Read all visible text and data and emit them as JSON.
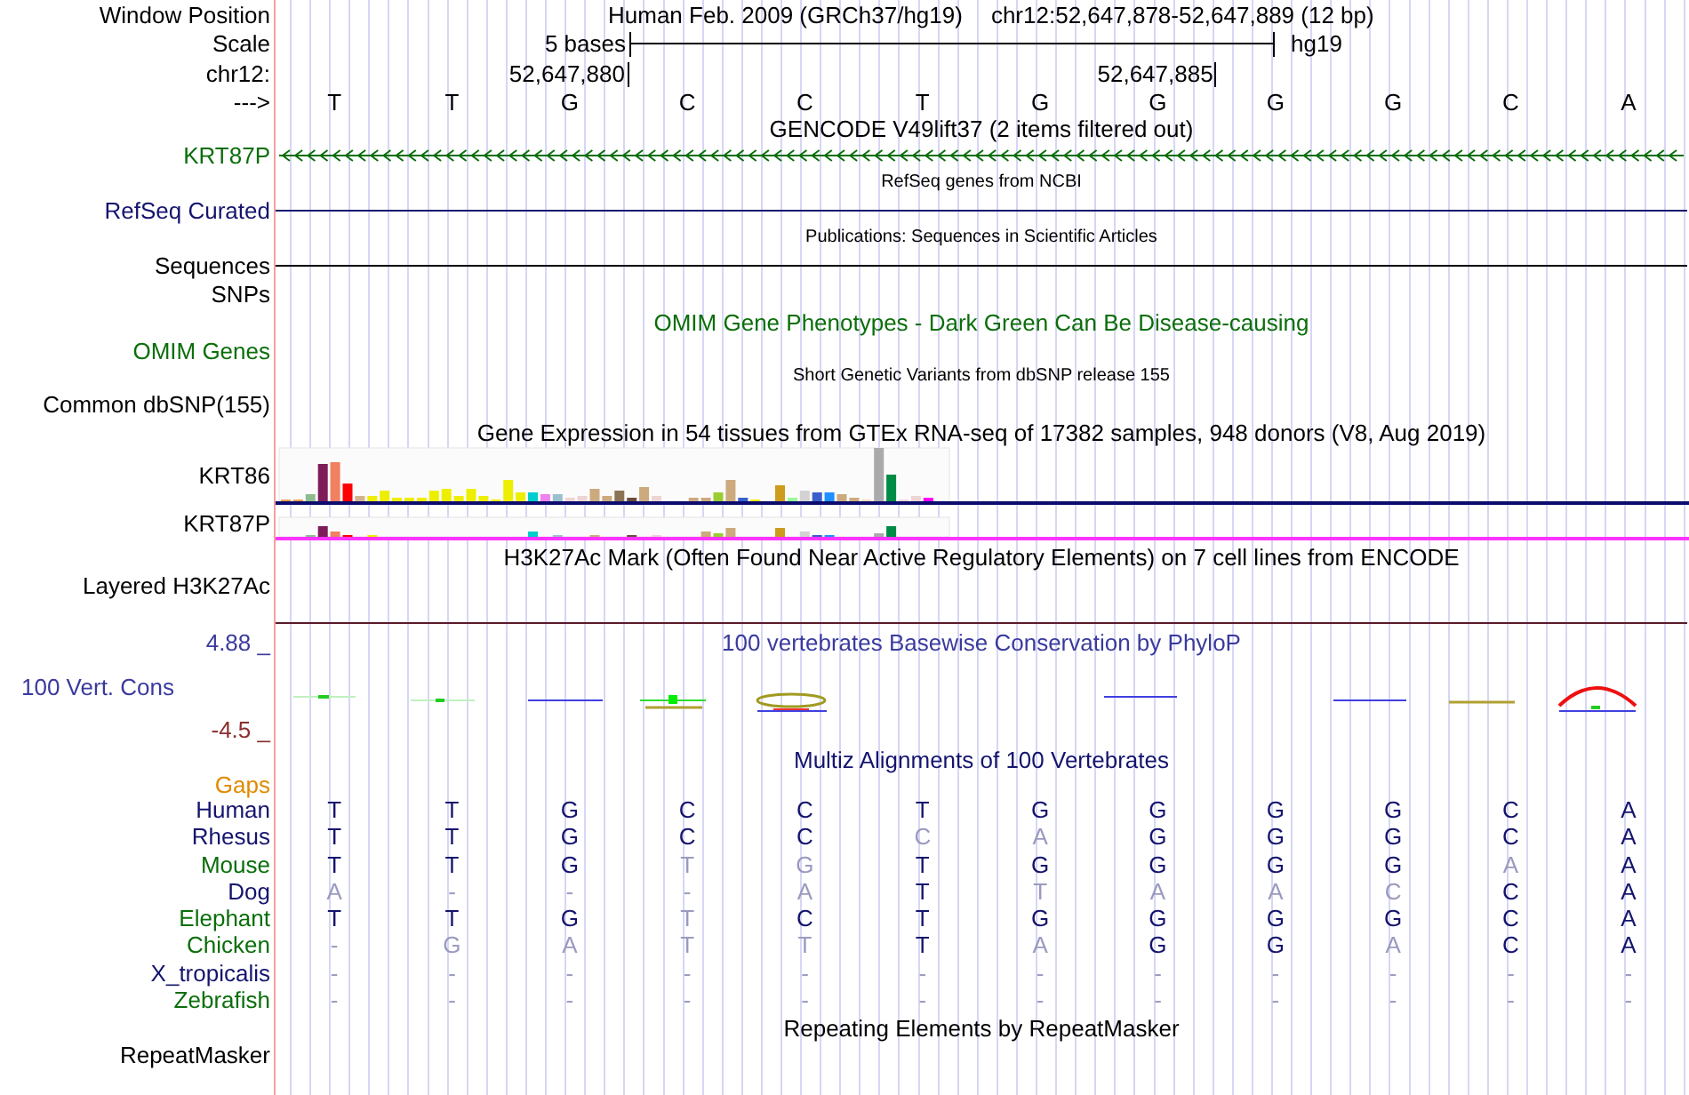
{
  "ruler": {
    "window_position_label": "Window Position",
    "assembly": "Human Feb. 2009 (GRCh37/hg19)",
    "position": "chr12:52,647,878-52,647,889 (12 bp)",
    "scale_label": "Scale",
    "scale_text": "5 bases",
    "scale_assembly": "hg19",
    "chrom_label": "chr12:",
    "ticks": [
      "52,647,880",
      "52,647,885"
    ],
    "strand_label": "--->",
    "bases": [
      "T",
      "T",
      "G",
      "C",
      "C",
      "T",
      "G",
      "G",
      "G",
      "G",
      "C",
      "A"
    ]
  },
  "gencode": {
    "title": "GENCODE V49lift37 (2 items filtered out)",
    "gene": "KRT87P"
  },
  "refseq": {
    "title": "RefSeq genes from NCBI",
    "label": "RefSeq Curated"
  },
  "publications": {
    "title": "Publications: Sequences in Scientific Articles",
    "label": "Sequences"
  },
  "snps": {
    "label": "SNPs"
  },
  "omim": {
    "title": "OMIM Gene Phenotypes - Dark Green Can Be Disease-causing",
    "label": "OMIM Genes"
  },
  "dbsnp": {
    "title": "Short Genetic Variants from dbSNP release 155",
    "label": "Common dbSNP(155)"
  },
  "gtex": {
    "title": "Gene Expression in 54 tissues from GTEx RNA-seq of 17382 samples, 948 donors (V8, Aug 2019)",
    "genes": [
      {
        "label": "KRT86"
      },
      {
        "label": "KRT87P"
      }
    ]
  },
  "h3k27ac": {
    "title": "H3K27Ac Mark (Often Found Near Active Regulatory Elements) on 7 cell lines from ENCODE",
    "label": "Layered H3K27Ac"
  },
  "phylop": {
    "title": "100 vertebrates Basewise Conservation by PhyloP",
    "label": "100 Vert. Cons",
    "y_max": "4.88 _",
    "y_min": "-4.5 _"
  },
  "multiz": {
    "title": "Multiz Alignments of 100 Vertebrates",
    "gaps_label": "Gaps",
    "species": [
      {
        "name": "Human",
        "color": "#14146e",
        "bases": [
          {
            "base": "T",
            "match": true
          },
          {
            "base": "T",
            "match": true
          },
          {
            "base": "G",
            "match": true
          },
          {
            "base": "C",
            "match": true
          },
          {
            "base": "C",
            "match": true
          },
          {
            "base": "T",
            "match": true
          },
          {
            "base": "G",
            "match": true
          },
          {
            "base": "G",
            "match": true
          },
          {
            "base": "G",
            "match": true
          },
          {
            "base": "G",
            "match": true
          },
          {
            "base": "C",
            "match": true
          },
          {
            "base": "A",
            "match": true
          }
        ]
      },
      {
        "name": "Rhesus",
        "color": "#14146e",
        "bases": [
          {
            "base": "T",
            "match": true
          },
          {
            "base": "T",
            "match": true
          },
          {
            "base": "G",
            "match": true
          },
          {
            "base": "C",
            "match": true
          },
          {
            "base": "C",
            "match": true
          },
          {
            "base": "C",
            "match": false
          },
          {
            "base": "A",
            "match": false
          },
          {
            "base": "G",
            "match": true
          },
          {
            "base": "G",
            "match": true
          },
          {
            "base": "G",
            "match": true
          },
          {
            "base": "C",
            "match": true
          },
          {
            "base": "A",
            "match": true
          }
        ]
      },
      {
        "name": "Mouse",
        "color": "#0a6e0a",
        "bases": [
          {
            "base": "T",
            "match": true
          },
          {
            "base": "T",
            "match": true
          },
          {
            "base": "G",
            "match": true
          },
          {
            "base": "T",
            "match": false
          },
          {
            "base": "G",
            "match": false
          },
          {
            "base": "T",
            "match": true
          },
          {
            "base": "G",
            "match": true
          },
          {
            "base": "G",
            "match": true
          },
          {
            "base": "G",
            "match": true
          },
          {
            "base": "G",
            "match": true
          },
          {
            "base": "A",
            "match": false
          },
          {
            "base": "A",
            "match": true
          }
        ]
      },
      {
        "name": "Dog",
        "color": "#14146e",
        "bases": [
          {
            "base": "A",
            "match": false
          },
          {
            "base": "-",
            "match": false
          },
          {
            "base": "-",
            "match": false
          },
          {
            "base": "-",
            "match": false
          },
          {
            "base": "A",
            "match": false
          },
          {
            "base": "T",
            "match": true
          },
          {
            "base": "T",
            "match": false
          },
          {
            "base": "A",
            "match": false
          },
          {
            "base": "A",
            "match": false
          },
          {
            "base": "C",
            "match": false
          },
          {
            "base": "C",
            "match": true
          },
          {
            "base": "A",
            "match": true
          }
        ]
      },
      {
        "name": "Elephant",
        "color": "#0a6e0a",
        "bases": [
          {
            "base": "T",
            "match": true
          },
          {
            "base": "T",
            "match": true
          },
          {
            "base": "G",
            "match": true
          },
          {
            "base": "T",
            "match": false
          },
          {
            "base": "C",
            "match": true
          },
          {
            "base": "T",
            "match": true
          },
          {
            "base": "G",
            "match": true
          },
          {
            "base": "G",
            "match": true
          },
          {
            "base": "G",
            "match": true
          },
          {
            "base": "G",
            "match": true
          },
          {
            "base": "C",
            "match": true
          },
          {
            "base": "A",
            "match": true
          }
        ]
      },
      {
        "name": "Chicken",
        "color": "#0a6e0a",
        "bases": [
          {
            "base": "-",
            "match": false
          },
          {
            "base": "G",
            "match": false
          },
          {
            "base": "A",
            "match": false
          },
          {
            "base": "T",
            "match": false
          },
          {
            "base": "T",
            "match": false
          },
          {
            "base": "T",
            "match": true
          },
          {
            "base": "A",
            "match": false
          },
          {
            "base": "G",
            "match": true
          },
          {
            "base": "G",
            "match": true
          },
          {
            "base": "A",
            "match": false
          },
          {
            "base": "C",
            "match": true
          },
          {
            "base": "A",
            "match": true
          }
        ]
      },
      {
        "name": "X_tropicalis",
        "color": "#14146e",
        "bases": [
          {
            "base": "-",
            "match": false
          },
          {
            "base": "-",
            "match": false
          },
          {
            "base": "-",
            "match": false
          },
          {
            "base": "-",
            "match": false
          },
          {
            "base": "-",
            "match": false
          },
          {
            "base": "-",
            "match": false
          },
          {
            "base": "-",
            "match": false
          },
          {
            "base": "-",
            "match": false
          },
          {
            "base": "-",
            "match": false
          },
          {
            "base": "-",
            "match": false
          },
          {
            "base": "-",
            "match": false
          },
          {
            "base": "-",
            "match": false
          }
        ]
      },
      {
        "name": "Zebrafish",
        "color": "#0a6e0a",
        "bases": [
          {
            "base": "-",
            "match": false
          },
          {
            "base": "-",
            "match": false
          },
          {
            "base": "-",
            "match": false
          },
          {
            "base": "-",
            "match": false
          },
          {
            "base": "-",
            "match": false
          },
          {
            "base": "-",
            "match": false
          },
          {
            "base": "-",
            "match": false
          },
          {
            "base": "-",
            "match": false
          },
          {
            "base": "-",
            "match": false
          },
          {
            "base": "-",
            "match": false
          },
          {
            "base": "-",
            "match": false
          },
          {
            "base": "-",
            "match": false
          }
        ]
      }
    ]
  },
  "repeatmasker": {
    "title": "Repeating Elements by RepeatMasker",
    "label": "RepeatMasker"
  }
}
